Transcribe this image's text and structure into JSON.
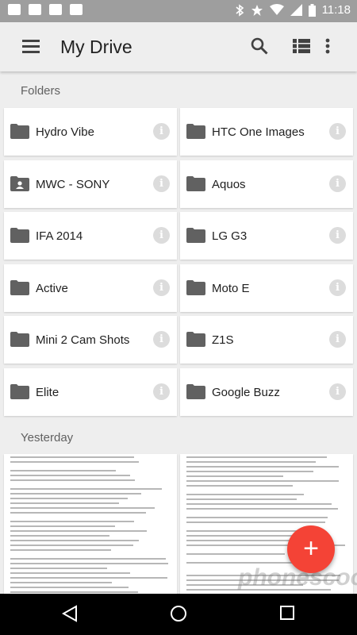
{
  "status_bar": {
    "time": "11:18"
  },
  "app_bar": {
    "title": "My Drive"
  },
  "sections": {
    "folders": "Folders",
    "yesterday": "Yesterday"
  },
  "folders": [
    {
      "name": "Hydro Vibe",
      "icon": "folder-icon"
    },
    {
      "name": "HTC One Images",
      "icon": "folder-icon"
    },
    {
      "name": "MWC - SONY",
      "icon": "shared-folder-icon"
    },
    {
      "name": "Aquos",
      "icon": "folder-icon"
    },
    {
      "name": "IFA 2014",
      "icon": "folder-icon"
    },
    {
      "name": "LG G3",
      "icon": "folder-icon"
    },
    {
      "name": "Active",
      "icon": "folder-icon"
    },
    {
      "name": "Moto E",
      "icon": "folder-icon"
    },
    {
      "name": "Mini 2 Cam Shots",
      "icon": "folder-icon"
    },
    {
      "name": "Z1S",
      "icon": "folder-icon"
    },
    {
      "name": "Elite",
      "icon": "folder-icon"
    },
    {
      "name": "Google Buzz",
      "icon": "folder-icon"
    }
  ],
  "info_glyph": "i",
  "fab": {
    "label": "+"
  },
  "watermark": "phonescoop",
  "colors": {
    "fab": "#f44336",
    "status_bar": "#9e9e9e",
    "app_bar": "#eeeeee"
  }
}
